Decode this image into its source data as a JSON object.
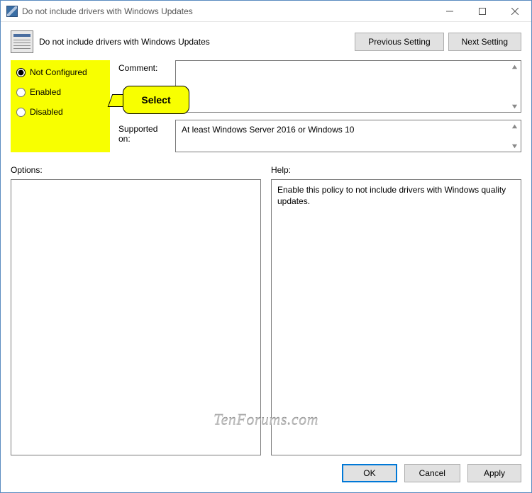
{
  "window": {
    "title": "Do not include drivers with Windows Updates"
  },
  "header": {
    "text": "Do not include drivers with Windows Updates",
    "prev": "Previous Setting",
    "next": "Next Setting"
  },
  "radios": {
    "not_configured": "Not Configured",
    "enabled": "Enabled",
    "disabled": "Disabled",
    "selected": "not_configured"
  },
  "callout": {
    "text": "Select"
  },
  "fields": {
    "comment_label": "Comment:",
    "comment_value": "",
    "supported_label": "Supported on:",
    "supported_value": "At least Windows Server 2016 or Windows 10"
  },
  "panes": {
    "options_label": "Options:",
    "help_label": "Help:",
    "help_text": "Enable this policy to not include drivers with Windows quality updates."
  },
  "footer": {
    "ok": "OK",
    "cancel": "Cancel",
    "apply": "Apply"
  },
  "watermark": "TenForums.com"
}
